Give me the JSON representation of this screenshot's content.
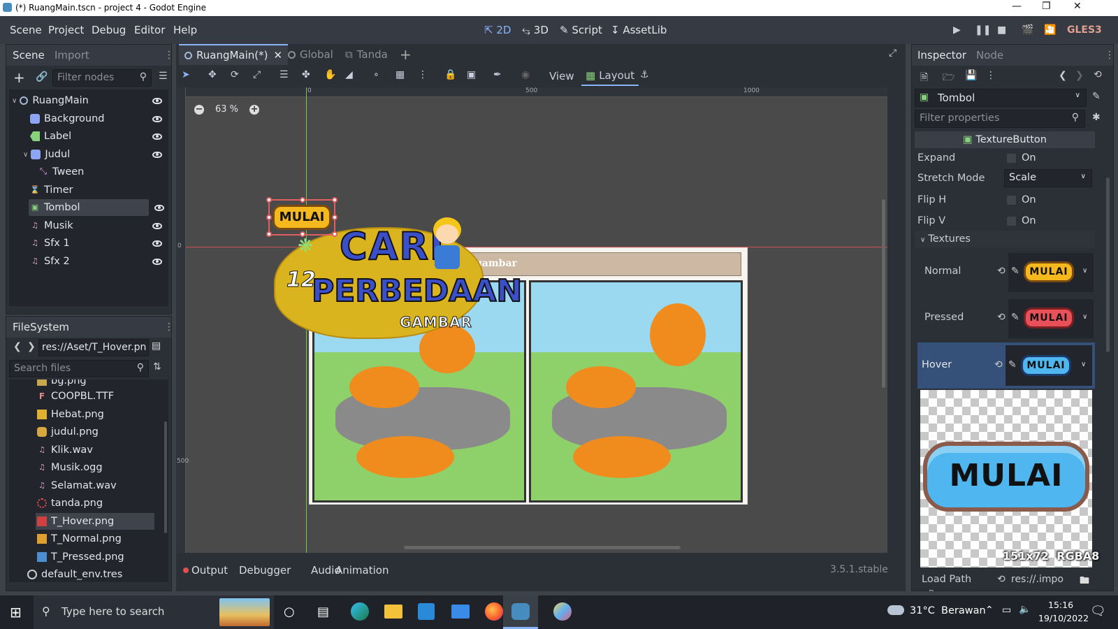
{
  "window": {
    "title": "(*) RuangMain.tscn - project 4 - Godot Engine"
  },
  "menu": [
    "Scene",
    "Project",
    "Debug",
    "Editor",
    "Help"
  ],
  "workspaces": {
    "two_d": "2D",
    "three_d": "3D",
    "script": "Script",
    "assetlib": "AssetLib"
  },
  "renderer": "GLES3",
  "scene_panel": {
    "tabs": [
      "Scene",
      "Import"
    ],
    "filter_placeholder": "Filter nodes",
    "nodes": [
      "RuangMain",
      "Background",
      "Label",
      "Judul",
      "Tween",
      "Timer",
      "Tombol",
      "Musik",
      "Sfx 1",
      "Sfx 2"
    ]
  },
  "filesystem": {
    "title": "FileSystem",
    "path": "res://Aset/T_Hover.pn",
    "search_placeholder": "Search files",
    "files": [
      "bg.png",
      "COOPBL.TTF",
      "Hebat.png",
      "judul.png",
      "Klik.wav",
      "Musik.ogg",
      "Selamat.wav",
      "tanda.png",
      "T_Hover.png",
      "T_Normal.png",
      "T_Pressed.png",
      "default_env.tres"
    ]
  },
  "editor": {
    "tabs": [
      "RuangMain(*)",
      "Global",
      "Tanda"
    ],
    "toolbar": {
      "view": "View",
      "layout": "Layout"
    },
    "zoom": "63 %",
    "ruler": [
      "0",
      "500",
      "1000"
    ],
    "vruler": [
      "0",
      "500"
    ],
    "canvas": {
      "button_text": "MULAI",
      "title_line1": "CARI",
      "title_num": "12",
      "title_line2": "PERBEDAAN",
      "title_line3": "GAMBAR",
      "banner_text": "gambar"
    }
  },
  "bottom": {
    "tabs": [
      "Output",
      "Debugger",
      "Audio",
      "Animation"
    ],
    "version": "3.5.1.stable"
  },
  "inspector": {
    "tabs": [
      "Inspector",
      "Node"
    ],
    "node_name": "Tombol",
    "filter_placeholder": "Filter properties",
    "class_name": "TextureButton",
    "props": [
      {
        "label": "Expand",
        "value": "On"
      },
      {
        "label": "Stretch Mode",
        "value": "Scale"
      },
      {
        "label": "Flip H",
        "value": "On"
      },
      {
        "label": "Flip V",
        "value": "On"
      }
    ],
    "textures_header": "Textures",
    "textures": [
      {
        "label": "Normal",
        "text": "MULAI"
      },
      {
        "label": "Pressed",
        "text": "MULAI"
      },
      {
        "label": "Hover",
        "text": "MULAI"
      }
    ],
    "preview_text": "MULAI",
    "preview_info": "151x72  RGBA8",
    "load_path_label": "Load Path",
    "load_path_value": "res://.impo",
    "resource_label": "Resource"
  },
  "taskbar": {
    "search_placeholder": "Type here to search",
    "weather": "31°C  Berawan",
    "time": "15:16",
    "date": "19/10/2022"
  },
  "colors": {
    "accent": "#8ab4f8",
    "panel": "#2b2f36",
    "canvas": "#4a4a4a",
    "selection": "#e05a5a"
  }
}
